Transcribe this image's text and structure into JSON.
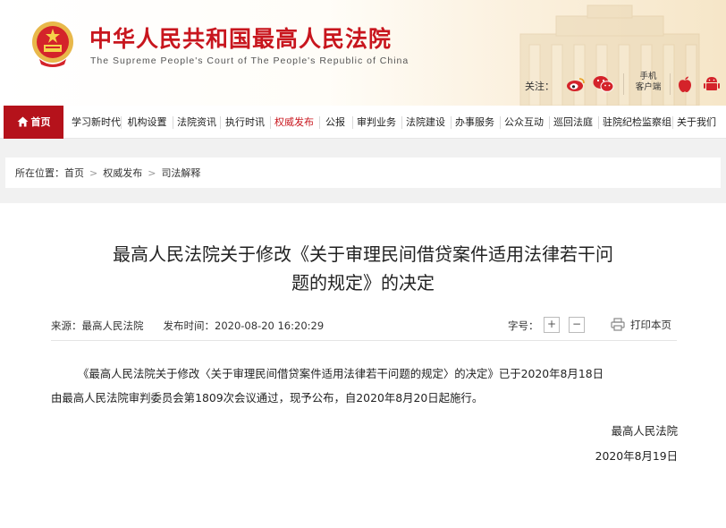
{
  "header": {
    "title": "中华人民共和国最高人民法院",
    "subtitle": "The Supreme People's Court of The People's Republic of China",
    "follow_label": "关注：",
    "mobile_label_1": "手机",
    "mobile_label_2": "客户端",
    "social_icons": [
      "weibo-icon",
      "wechat-icon",
      "apple-icon",
      "android-icon"
    ]
  },
  "nav": {
    "items": [
      {
        "label": "首页"
      },
      {
        "label": "学习新时代"
      },
      {
        "label": "机构设置"
      },
      {
        "label": "法院资讯"
      },
      {
        "label": "执行时讯"
      },
      {
        "label": "权威发布"
      },
      {
        "label": "公报"
      },
      {
        "label": "审判业务"
      },
      {
        "label": "法院建设"
      },
      {
        "label": "办事服务"
      },
      {
        "label": "公众互动"
      },
      {
        "label": "巡回法庭"
      },
      {
        "label": "驻院纪检监察组"
      },
      {
        "label": "关于我们"
      }
    ],
    "active_index": 5
  },
  "breadcrumb": {
    "prefix": "所在位置：",
    "items": [
      "首页",
      "权威发布",
      "司法解释"
    ],
    "separator": ">"
  },
  "article": {
    "title_line1": "最高人民法院关于修改《关于审理民间借贷案件适用法律若干问",
    "title_line2": "题的规定》的决定",
    "source_label": "来源：",
    "source": "最高人民法院",
    "time_label": "发布时间：",
    "time": "2020-08-20 16:20:29",
    "fontsize_label": "字号：",
    "increase": "+",
    "decrease": "−",
    "print_label": "打印本页",
    "body_line1": "《最高人民法院关于修改〈关于审理民间借贷案件适用法律若干问题的规定〉的决定》已于2020年8月18日",
    "body_line2": "由最高人民法院审判委员会第1809次会议通过，现予公布，自2020年8月20日起施行。",
    "signature": "最高人民法院",
    "date": "2020年8月19日"
  },
  "colors": {
    "brand_red": "#c8161e",
    "nav_home_bg": "#b5121b",
    "gold": "#e8b84a"
  }
}
